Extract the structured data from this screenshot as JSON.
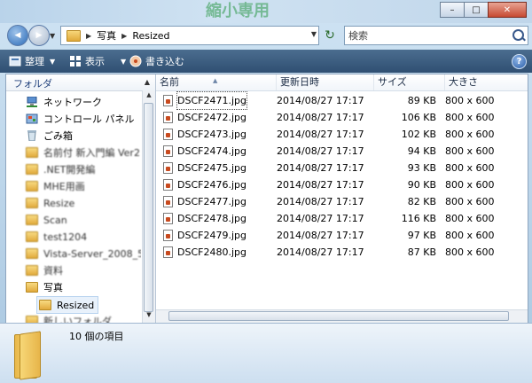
{
  "window": {
    "title_decoration": "縮小専用",
    "controls": {
      "minimize": "–",
      "maximize": "□",
      "close": "✕"
    }
  },
  "nav": {
    "back_glyph": "◀",
    "forward_glyph": "▶",
    "breadcrumb": [
      "写真",
      "Resized"
    ],
    "breadcrumb_sep": "▶",
    "refresh_glyph": "↻",
    "search_placeholder": "検索"
  },
  "toolbar": {
    "organize": "整理",
    "views": "表示",
    "burn": "書き込む",
    "help": "?"
  },
  "navpane": {
    "header": "フォルダ",
    "items": [
      {
        "label": "ネットワーク",
        "icon": "network-icon",
        "blurred": false
      },
      {
        "label": "コントロール パネル",
        "icon": "control-panel-icon",
        "blurred": false
      },
      {
        "label": "ごみ箱",
        "icon": "recycle-bin-icon",
        "blurred": false
      },
      {
        "label": "名前付 新入門編 Ver2",
        "icon": "folder-icon",
        "blurred": true
      },
      {
        "label": ".NET開発編",
        "icon": "folder-icon",
        "blurred": true
      },
      {
        "label": "MHE用画",
        "icon": "folder-icon",
        "blurred": true
      },
      {
        "label": "Resize",
        "icon": "folder-icon",
        "blurred": true
      },
      {
        "label": "Scan",
        "icon": "folder-icon",
        "blurred": true
      },
      {
        "label": "test1204",
        "icon": "folder-icon",
        "blurred": true
      },
      {
        "label": "Vista-Server_2008_5",
        "icon": "folder-icon",
        "blurred": true
      },
      {
        "label": "資料",
        "icon": "folder-icon",
        "blurred": true
      },
      {
        "label": "写真",
        "icon": "folder-icon",
        "blurred": false
      },
      {
        "label": "Resized",
        "icon": "folder-icon",
        "blurred": false,
        "selected": true
      },
      {
        "label": "新しいフォルダ",
        "icon": "folder-icon",
        "blurred": true
      }
    ]
  },
  "columns": {
    "name": "名前",
    "modified": "更新日時",
    "size": "サイズ",
    "dimensions": "大きさ"
  },
  "files": [
    {
      "name": "DSCF2471.jpg",
      "modified": "2014/08/27 17:17",
      "size": "89 KB",
      "dimensions": "800 x 600"
    },
    {
      "name": "DSCF2472.jpg",
      "modified": "2014/08/27 17:17",
      "size": "106 KB",
      "dimensions": "800 x 600"
    },
    {
      "name": "DSCF2473.jpg",
      "modified": "2014/08/27 17:17",
      "size": "102 KB",
      "dimensions": "800 x 600"
    },
    {
      "name": "DSCF2474.jpg",
      "modified": "2014/08/27 17:17",
      "size": "94 KB",
      "dimensions": "800 x 600"
    },
    {
      "name": "DSCF2475.jpg",
      "modified": "2014/08/27 17:17",
      "size": "93 KB",
      "dimensions": "800 x 600"
    },
    {
      "name": "DSCF2476.jpg",
      "modified": "2014/08/27 17:17",
      "size": "90 KB",
      "dimensions": "800 x 600"
    },
    {
      "name": "DSCF2477.jpg",
      "modified": "2014/08/27 17:17",
      "size": "82 KB",
      "dimensions": "800 x 600"
    },
    {
      "name": "DSCF2478.jpg",
      "modified": "2014/08/27 17:17",
      "size": "116 KB",
      "dimensions": "800 x 600"
    },
    {
      "name": "DSCF2479.jpg",
      "modified": "2014/08/27 17:17",
      "size": "97 KB",
      "dimensions": "800 x 600"
    },
    {
      "name": "DSCF2480.jpg",
      "modified": "2014/08/27 17:17",
      "size": "87 KB",
      "dimensions": "800 x 600"
    }
  ],
  "details": {
    "item_count": "10 個の項目"
  },
  "colors": {
    "toolbar": "#3a5c80",
    "accent": "#2b6bb8",
    "folder": "#e7b54a"
  }
}
